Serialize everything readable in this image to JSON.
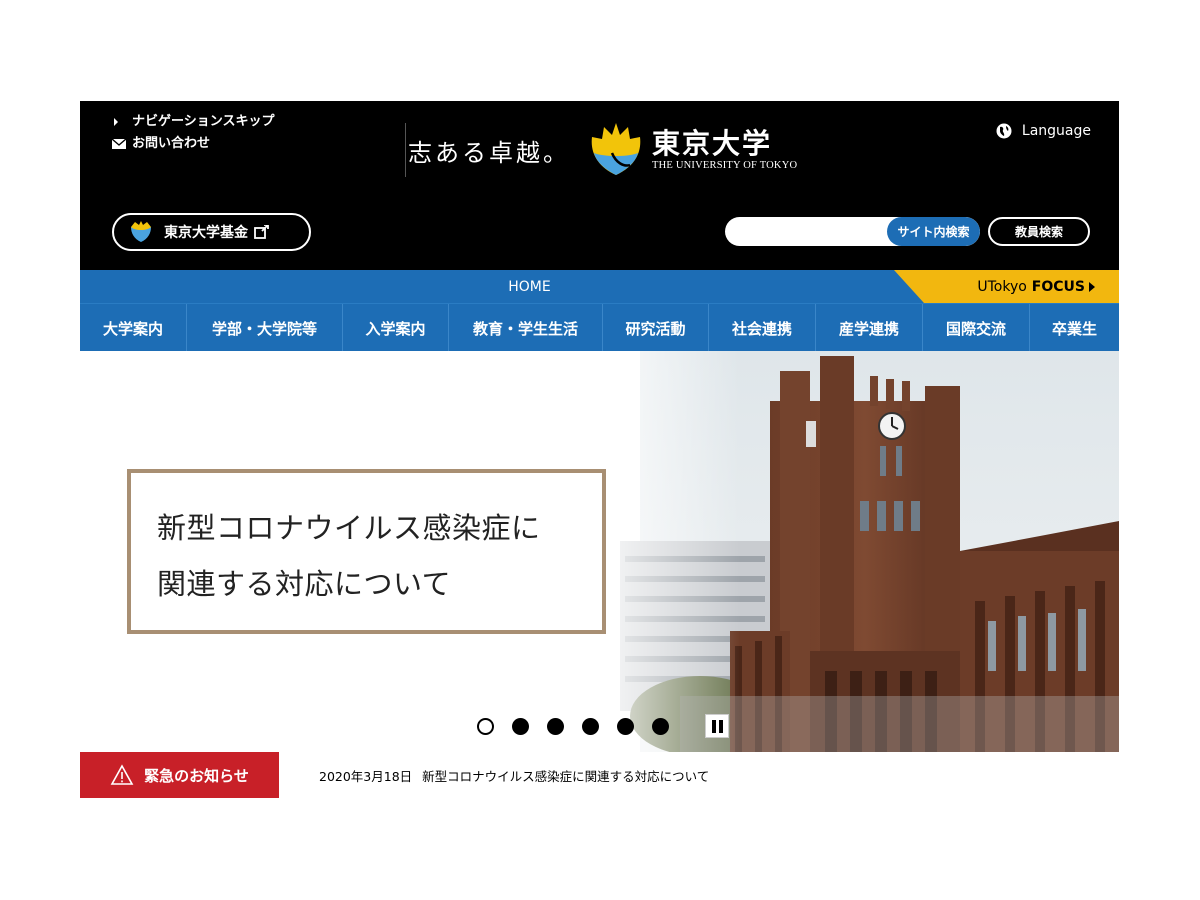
{
  "header": {
    "skip_nav": "ナビゲーションスキップ",
    "contact": "お問い合わせ",
    "motto": "志ある卓越。",
    "logo_ja": "東京大学",
    "logo_en": "THE UNIVERSITY OF TOKYO",
    "language": "Language",
    "fund_label": "東京大学基金",
    "search_placeholder": "",
    "search_button": "サイト内検索",
    "faculty_search": "教員検索"
  },
  "nav": {
    "home": "HOME",
    "focus_prefix": "UTokyo",
    "focus_bold": "FOCUS",
    "items": [
      {
        "label": "大学案内"
      },
      {
        "label": "学部・大学院等"
      },
      {
        "label": "入学案内"
      },
      {
        "label": "教育・学生生活"
      },
      {
        "label": "研究活動"
      },
      {
        "label": "社会連携"
      },
      {
        "label": "産学連携"
      },
      {
        "label": "国際交流"
      },
      {
        "label": "卒業生"
      }
    ]
  },
  "hero": {
    "headline_line1": "新型コロナウイルス感染症に",
    "headline_line2": "関連する対応について",
    "slide_count": 6,
    "active_slide": 1
  },
  "emergency": {
    "label": "緊急のお知らせ",
    "date": "2020年3月18日",
    "text": "新型コロナウイルス感染症に関連する対応について"
  },
  "colors": {
    "header_bg": "#000000",
    "nav_blue": "#1d6db5",
    "focus_yellow": "#f2b70f",
    "alert_red": "#c82028",
    "headline_border": "#a88f73"
  }
}
